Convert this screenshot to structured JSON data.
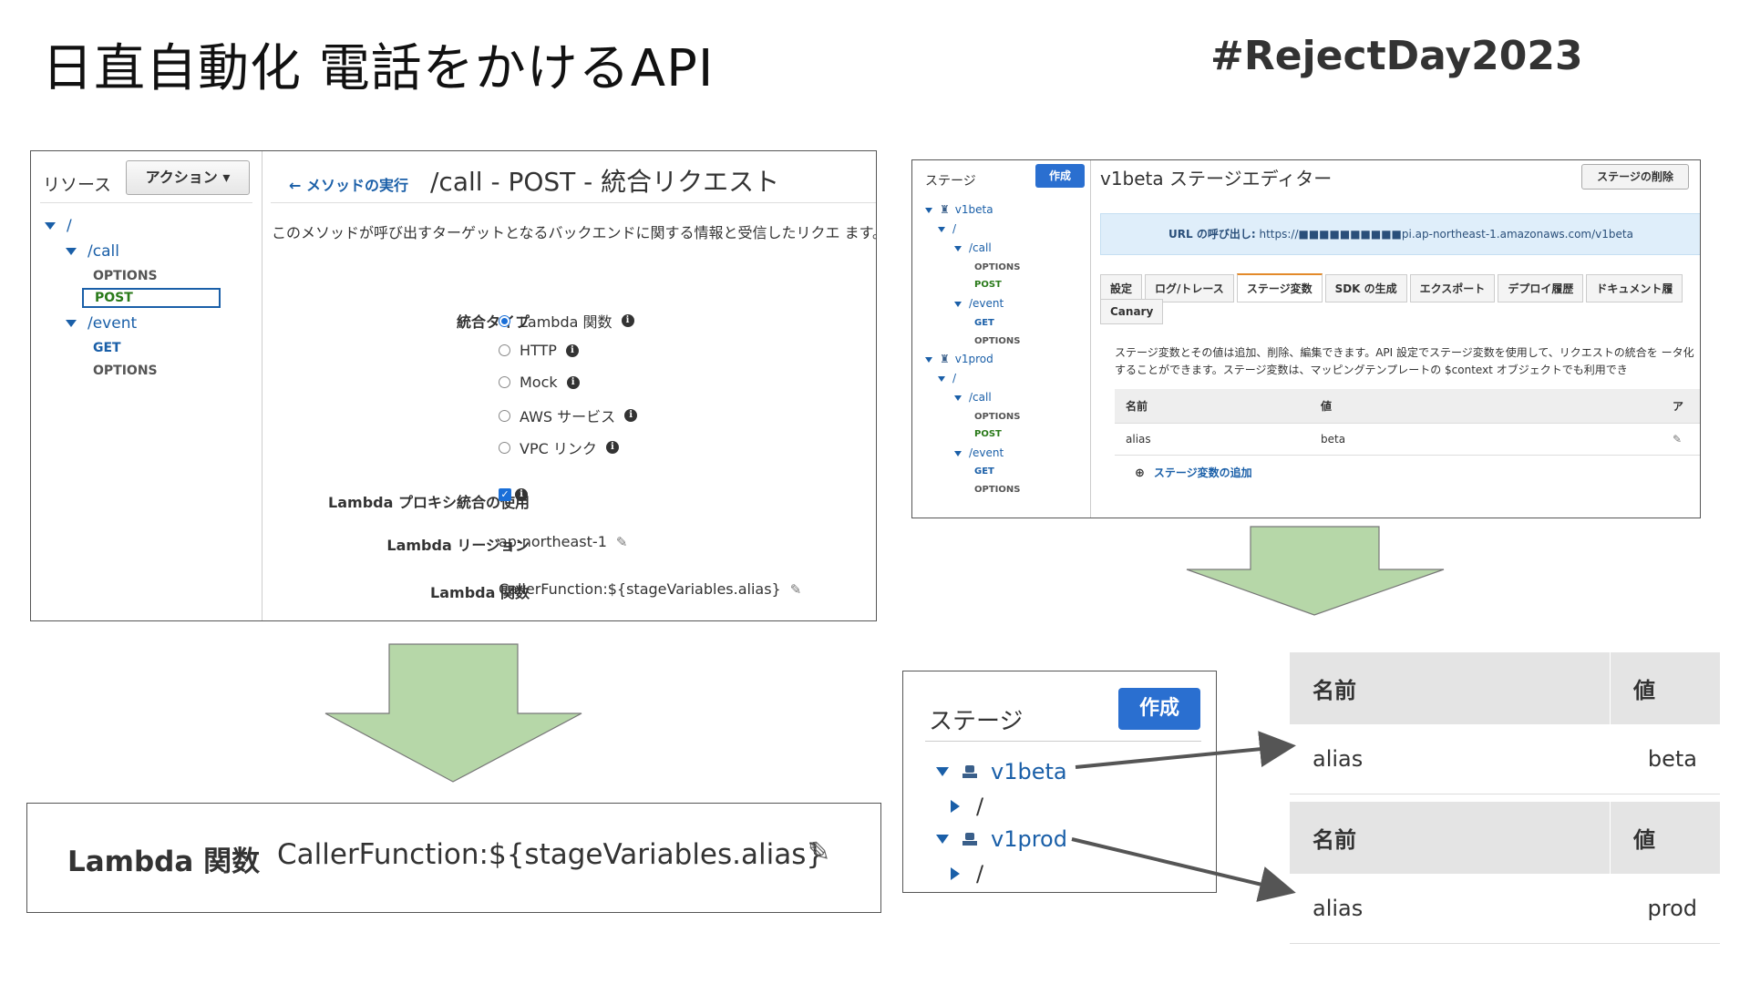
{
  "page": {
    "title": "日直自動化 電話をかけるAPI",
    "hashtag": "#RejectDay2023"
  },
  "resources_panel": {
    "label": "リソース",
    "action_button": "アクション ▾",
    "tree": {
      "root": "/",
      "call": "/call",
      "call_methods": [
        "OPTIONS",
        "POST"
      ],
      "event": "/event",
      "event_methods": [
        "GET",
        "OPTIONS"
      ]
    },
    "back_link": "← メソッドの実行",
    "heading": "/call - POST - 統合リクエスト",
    "description": "このメソッドが呼び出すターゲットとなるバックエンドに関する情報と受信したリクエ ます。",
    "integration_type_label": "統合タイプ",
    "integration_types": [
      "Lambda 関数",
      "HTTP",
      "Mock",
      "AWS サービス",
      "VPC リンク"
    ],
    "selected_integration_type": "Lambda 関数",
    "proxy_label": "Lambda プロキシ統合の使用",
    "proxy_checked": true,
    "region_label": "Lambda リージョン",
    "region_value": "ap-northeast-1",
    "function_label": "Lambda 関数",
    "function_value": "CallerFunction:${stageVariables.alias}"
  },
  "zoom_function": {
    "label": "Lambda 関数",
    "value": "CallerFunction:${stageVariables.alias}"
  },
  "stage_editor": {
    "stages_label": "ステージ",
    "create_button": "作成",
    "tree": [
      {
        "stage": "v1beta",
        "root": "/",
        "call": "/call",
        "call_methods": [
          "OPTIONS",
          "POST"
        ],
        "event": "/event",
        "event_methods": [
          "GET",
          "OPTIONS"
        ]
      },
      {
        "stage": "v1prod",
        "root": "/",
        "call": "/call",
        "call_methods": [
          "OPTIONS",
          "POST"
        ],
        "event": "/event",
        "event_methods": [
          "GET",
          "OPTIONS"
        ]
      }
    ],
    "title": "v1beta ステージエディター",
    "delete_button": "ステージの削除",
    "url_label": "URL の呼び出し:",
    "url_value": "https://■■■■■■■■■■pi.ap-northeast-1.amazonaws.com/v1beta",
    "tabs": [
      "設定",
      "ログ/トレース",
      "ステージ変数",
      "SDK の生成",
      "エクスポート",
      "デプロイ履歴",
      "ドキュメント履"
    ],
    "active_tab": "ステージ変数",
    "canary_tab": "Canary",
    "description": "ステージ変数とその値は追加、削除、編集できます。API 設定でステージ変数を使用して、リクエストの統合を ータ化することができます。ステージ変数は、マッピングテンプレートの $context オブジェクトでも利用でき",
    "table_headers": [
      "名前",
      "値",
      "ア"
    ],
    "table_rows": [
      [
        "alias",
        "beta"
      ]
    ],
    "add_variable": "ステージ変数の追加"
  },
  "stage_zoom": {
    "label": "ステージ",
    "create_button": "作成",
    "stages": [
      "v1beta",
      "v1prod"
    ],
    "child": "/"
  },
  "variable_tables": [
    {
      "headers": [
        "名前",
        "値"
      ],
      "name": "alias",
      "value": "beta"
    },
    {
      "headers": [
        "名前",
        "値"
      ],
      "name": "alias",
      "value": "prod"
    }
  ],
  "colors": {
    "arrow_fill": "#b6d7a8",
    "link_blue": "#1a5fa8",
    "button_blue": "#2a6fd0"
  }
}
